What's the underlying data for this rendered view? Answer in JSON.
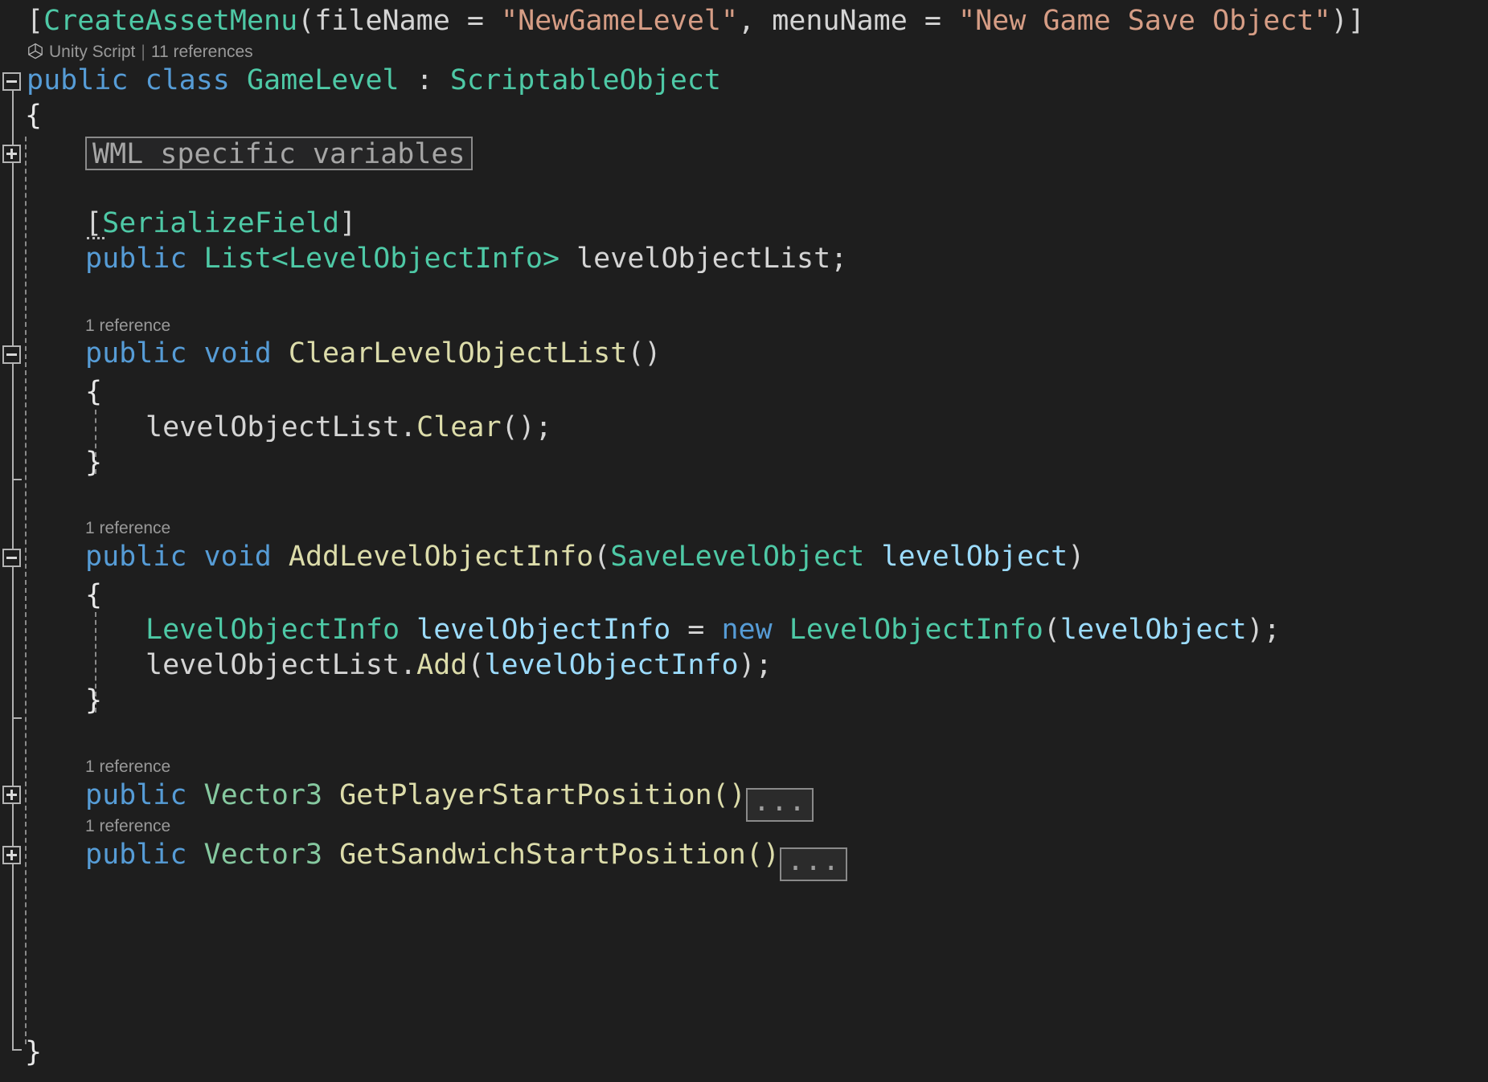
{
  "editor": {
    "language": "csharp",
    "theme": "dark",
    "background_color": "#1e1e1e",
    "foreground_color": "#d4d4d4"
  },
  "codelens": {
    "class_lens": {
      "icon": "unity-cube-icon",
      "label": "Unity Script",
      "separator": "|",
      "references": "11 references"
    },
    "clear_level_object_list": "1 reference",
    "add_level_object_info": "1 reference",
    "get_player_start_position": "1 reference",
    "get_sandwich_start_position": "1 reference"
  },
  "collapsed": {
    "region_label": "WML specific variables",
    "ellipsis": "..."
  },
  "code": {
    "attribute_line": {
      "open_bracket": "[",
      "attr_name": "CreateAssetMenu",
      "open_paren": "(",
      "param1_name": "fileName",
      "equals1": " = ",
      "param1_value": "\"NewGameLevel\"",
      "comma": ", ",
      "param2_name": "menuName",
      "equals2": " = ",
      "param2_value": "\"New Game Save Object\"",
      "close_paren": ")",
      "close_bracket": "]"
    },
    "class_decl": {
      "modifier": "public",
      "keyword": "class",
      "name": "GameLevel",
      "colon": " : ",
      "base": "ScriptableObject"
    },
    "class_open_brace": "{",
    "class_close_brace": "}",
    "serialize_field_attr": "[SerializeField]",
    "serialize_field_attr_open": "[",
    "serialize_field_attr_name": "SerializeField",
    "serialize_field_attr_close": "]",
    "list_field": {
      "modifier": "public",
      "type_generic_open": "List<",
      "type_arg": "LevelObjectInfo",
      "type_generic_close": ">",
      "name": " levelObjectList;"
    },
    "clear_method": {
      "modifier": "public",
      "return_type": "void",
      "name": "ClearLevelObjectList",
      "parens": "()",
      "open_brace": "{",
      "close_brace": "}",
      "body_receiver": "levelObjectList",
      "body_dot": ".",
      "body_call": "Clear",
      "body_tail": "();"
    },
    "add_method": {
      "modifier": "public",
      "return_type": "void",
      "name": "AddLevelObjectInfo",
      "open_paren": "(",
      "param_type": "SaveLevelObject",
      "param_name": " levelObject",
      "close_paren": ")",
      "open_brace": "{",
      "close_brace": "}",
      "line1_type": "LevelObjectInfo",
      "line1_var": " levelObjectInfo",
      "line1_eq": " = ",
      "line1_new": "new",
      "line1_ctor": "LevelObjectInfo",
      "line1_open": "(",
      "line1_arg": "levelObject",
      "line1_close": ");",
      "line2_receiver": "levelObjectList",
      "line2_dot": ".",
      "line2_call": "Add",
      "line2_open": "(",
      "line2_arg": "levelObjectInfo",
      "line2_close": ");"
    },
    "get_player_start_position": {
      "modifier": "public",
      "return_type": "Vector3",
      "name": "GetPlayerStartPosition",
      "parens": "()"
    },
    "get_sandwich_start_position": {
      "modifier": "public",
      "return_type": "Vector3",
      "name": "GetSandwichStartPosition",
      "parens": "()"
    }
  }
}
